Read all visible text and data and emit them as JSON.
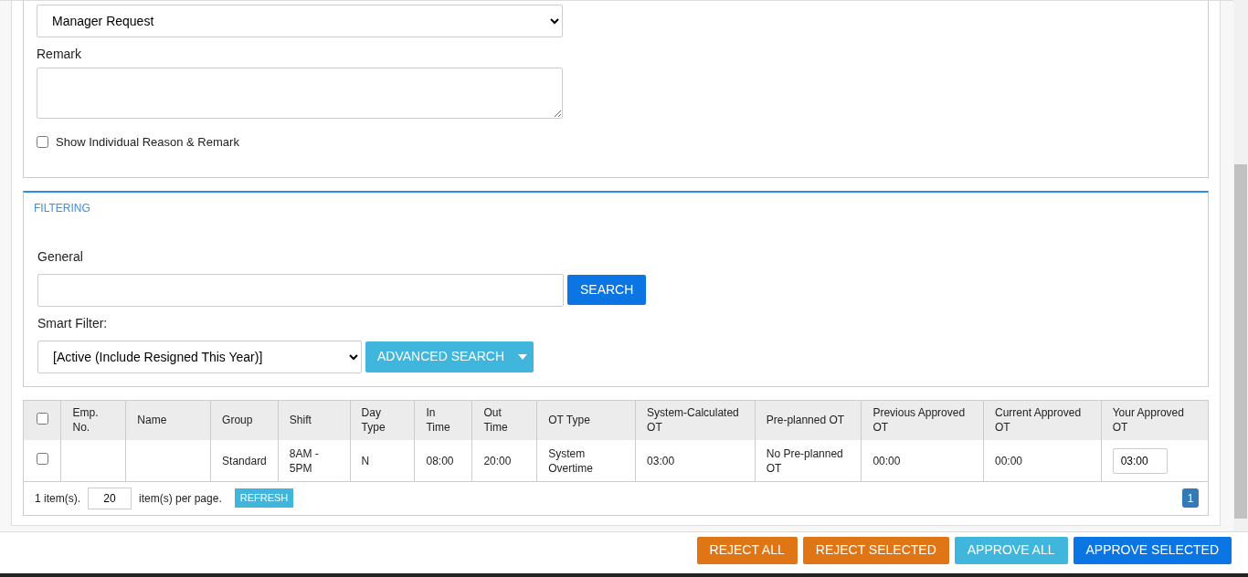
{
  "reason": {
    "value": "Manager Request"
  },
  "remark": {
    "label": "Remark"
  },
  "show_individual": {
    "label": "Show Individual Reason & Remark",
    "checked": false
  },
  "filtering": {
    "title": "FILTERING",
    "general_label": "General",
    "search_button": "SEARCH",
    "smart_filter_label": "Smart Filter:",
    "smart_filter_value": "[Active (Include Resigned This Year)]",
    "advanced_button": "ADVANCED SEARCH"
  },
  "table": {
    "select_all_checked": false,
    "columns": [
      "Emp. No.",
      "Name",
      "Group",
      "Shift",
      "Day Type",
      "In Time",
      "Out Time",
      "OT Type",
      "System-Calculated OT",
      "Pre-planned OT",
      "Previous Approved OT",
      "Current Approved OT",
      "Your Approved OT"
    ],
    "rows": [
      {
        "selected": false,
        "cells": [
          "",
          "",
          "Standard",
          "8AM - 5PM",
          "N",
          "08:00",
          "20:00",
          "System Overtime",
          "03:00",
          "No Pre-planned OT",
          "00:00",
          "00:00"
        ],
        "your_approved": "03:00"
      }
    ]
  },
  "pager": {
    "count": "1 item(s).",
    "page_size": "20",
    "per_page": "item(s) per page.",
    "refresh": "REFRESH",
    "pages": [
      {
        "label": "1",
        "selected": true
      }
    ]
  },
  "actions": [
    {
      "label": "REJECT ALL",
      "kind": "reject"
    },
    {
      "label": "REJECT SELECTED",
      "kind": "reject"
    },
    {
      "label": "APPROVE ALL",
      "kind": "approve_all"
    },
    {
      "label": "APPROVE SELECTED",
      "kind": "approve"
    }
  ]
}
